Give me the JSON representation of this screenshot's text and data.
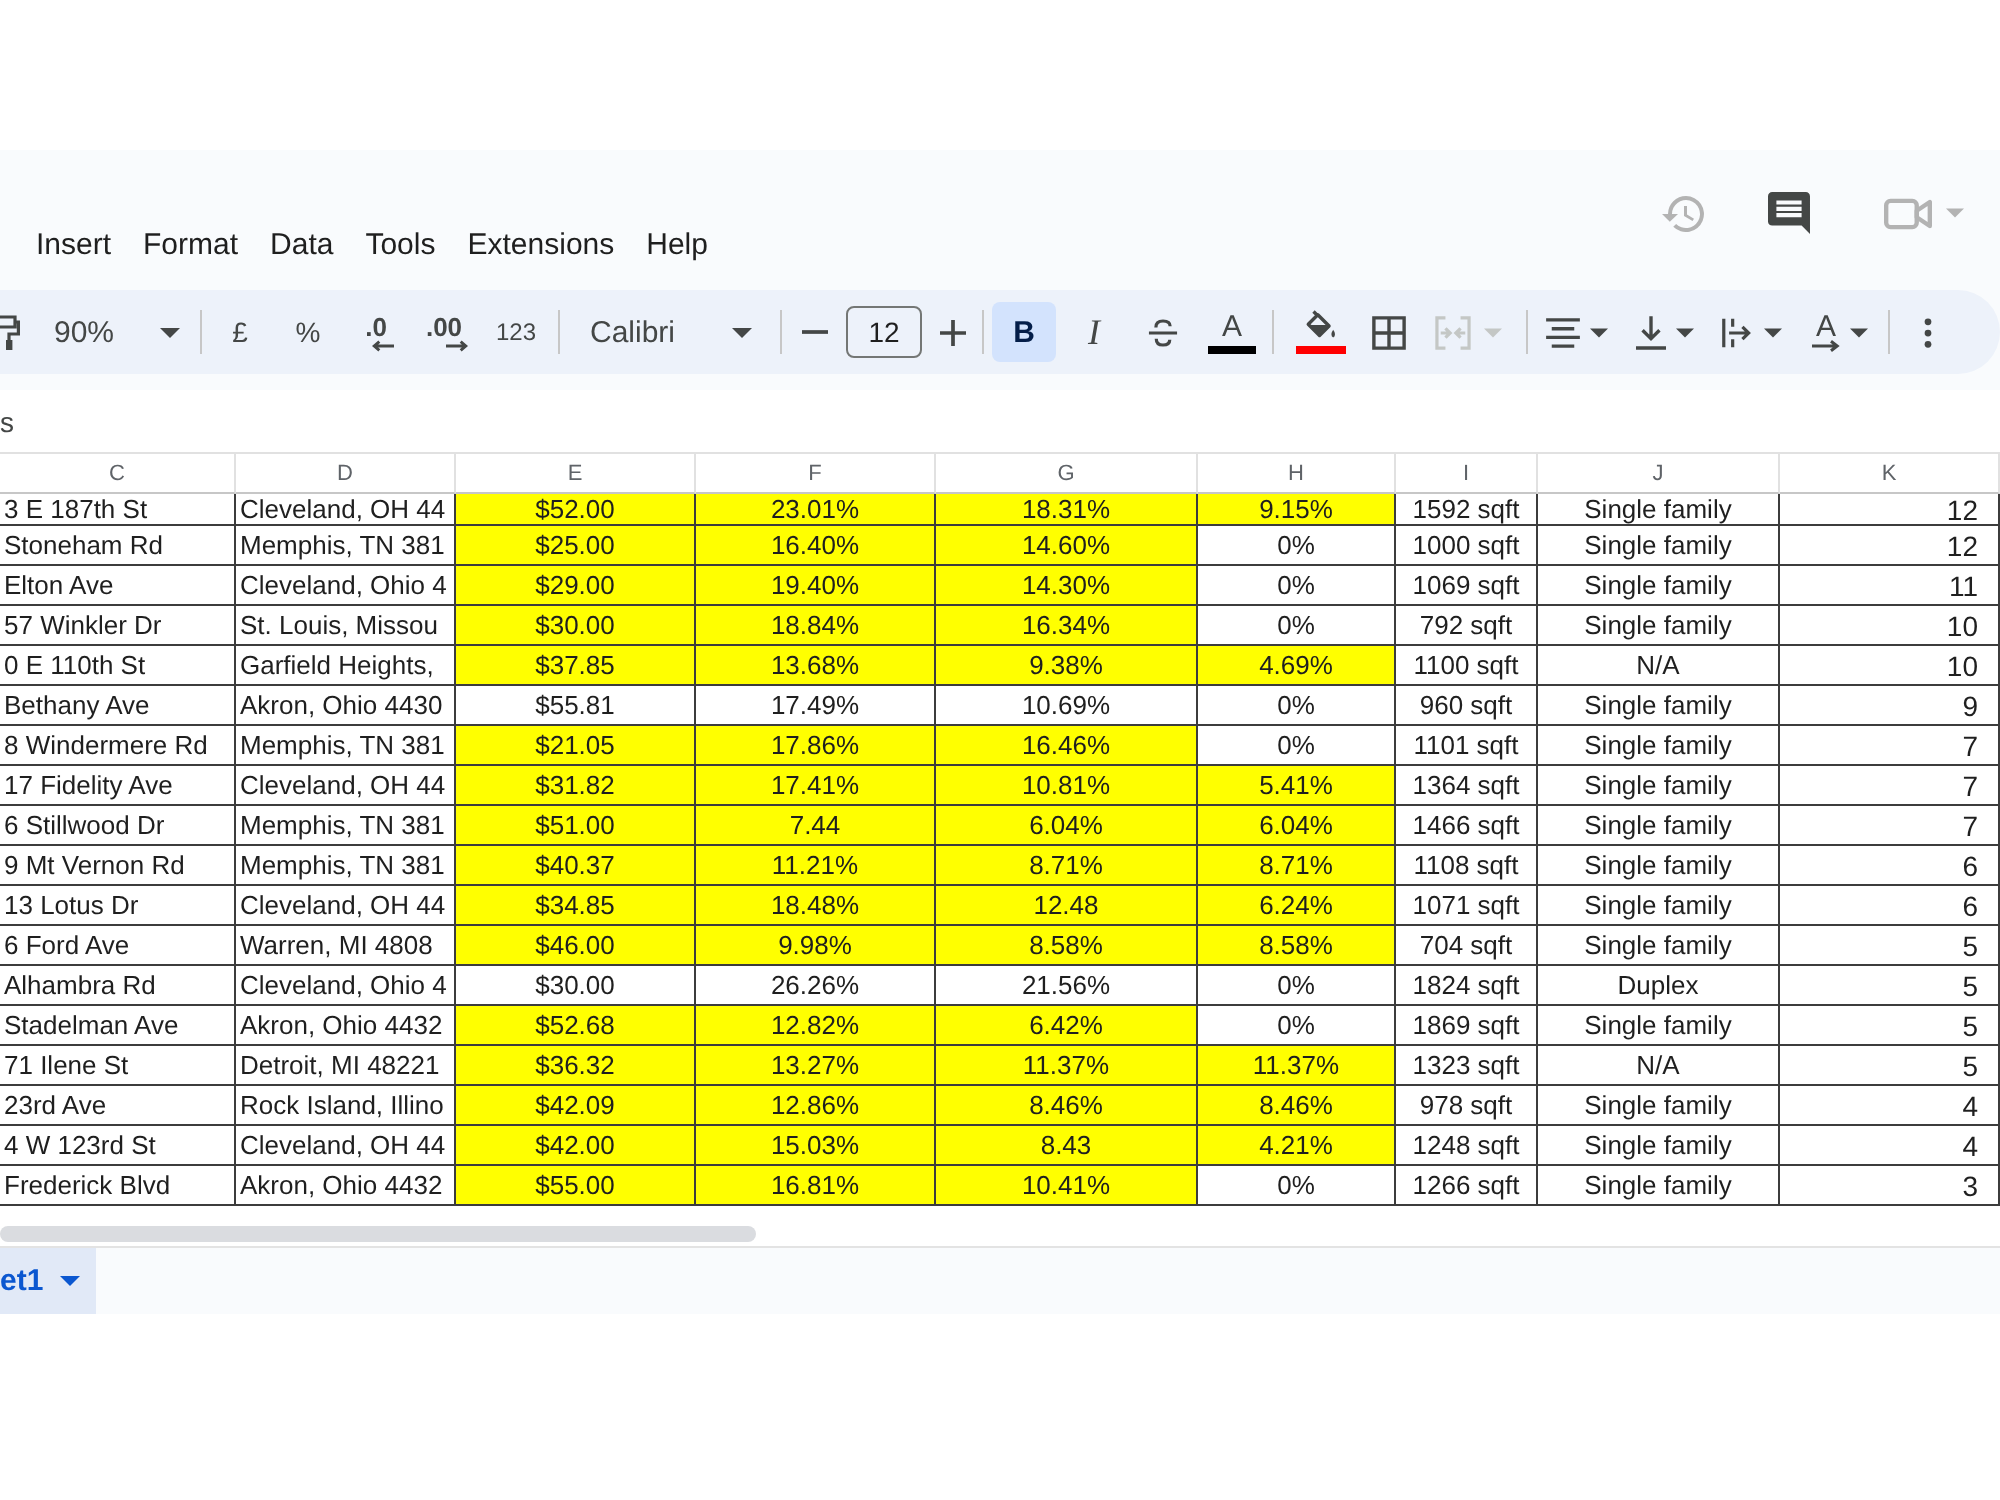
{
  "menu": [
    "Insert",
    "Format",
    "Data",
    "Tools",
    "Extensions",
    "Help"
  ],
  "toolbar": {
    "zoom": "90%",
    "currency": "£",
    "percent": "%",
    "decrease_decimal": ".0",
    "increase_decimal": ".00",
    "number_format": "123",
    "font": "Calibri",
    "font_size": "12",
    "bold": {
      "label": "B",
      "selected": true
    },
    "italic": {
      "label": "I",
      "selected": false
    },
    "strikethrough": {
      "selected": false
    },
    "text_color": {
      "label": "A",
      "color": "#000000"
    },
    "fill_color": {
      "color": "#ff0000"
    },
    "merge": {
      "disabled": true
    },
    "text_rotation": {
      "label": "A"
    }
  },
  "formula_bar": {
    "name_box": "s"
  },
  "sheet": {
    "columns": [
      "C",
      "D",
      "E",
      "F",
      "G",
      "H",
      "I",
      "J",
      "K"
    ],
    "rows": [
      {
        "cells": [
          {
            "text": "3 E 187th St",
            "highlighted": false
          },
          {
            "text": "Cleveland, OH 44",
            "highlighted": false
          },
          {
            "text": "$52.00",
            "highlighted": true
          },
          {
            "text": "23.01%",
            "highlighted": true
          },
          {
            "text": "18.31%",
            "highlighted": true
          },
          {
            "text": "9.15%",
            "highlighted": true
          },
          {
            "text": "1592 sqft",
            "highlighted": false
          },
          {
            "text": "Single family",
            "highlighted": false
          },
          {
            "text": "12",
            "highlighted": false
          }
        ]
      },
      {
        "cells": [
          {
            "text": "Stoneham Rd",
            "highlighted": false
          },
          {
            "text": "Memphis, TN 381",
            "highlighted": false
          },
          {
            "text": "$25.00",
            "highlighted": true
          },
          {
            "text": "16.40%",
            "highlighted": true
          },
          {
            "text": "14.60%",
            "highlighted": true
          },
          {
            "text": "0%",
            "highlighted": false
          },
          {
            "text": "1000 sqft",
            "highlighted": false
          },
          {
            "text": "Single family",
            "highlighted": false
          },
          {
            "text": "12",
            "highlighted": false
          }
        ]
      },
      {
        "cells": [
          {
            "text": "Elton Ave",
            "highlighted": false
          },
          {
            "text": "Cleveland, Ohio 4",
            "highlighted": false
          },
          {
            "text": "$29.00",
            "highlighted": true
          },
          {
            "text": "19.40%",
            "highlighted": true
          },
          {
            "text": "14.30%",
            "highlighted": true
          },
          {
            "text": "0%",
            "highlighted": false
          },
          {
            "text": "1069 sqft",
            "highlighted": false
          },
          {
            "text": "Single family",
            "highlighted": false
          },
          {
            "text": "11",
            "highlighted": false
          }
        ]
      },
      {
        "cells": [
          {
            "text": "57 Winkler Dr",
            "highlighted": false
          },
          {
            "text": "St. Louis, Missou",
            "highlighted": false
          },
          {
            "text": "$30.00",
            "highlighted": true
          },
          {
            "text": "18.84%",
            "highlighted": true
          },
          {
            "text": "16.34%",
            "highlighted": true
          },
          {
            "text": "0%",
            "highlighted": false
          },
          {
            "text": "792 sqft",
            "highlighted": false
          },
          {
            "text": "Single family",
            "highlighted": false
          },
          {
            "text": "10",
            "highlighted": false
          }
        ]
      },
      {
        "cells": [
          {
            "text": "0 E 110th St",
            "highlighted": false
          },
          {
            "text": "Garfield Heights,",
            "highlighted": false
          },
          {
            "text": "$37.85",
            "highlighted": true
          },
          {
            "text": "13.68%",
            "highlighted": true
          },
          {
            "text": "9.38%",
            "highlighted": true
          },
          {
            "text": "4.69%",
            "highlighted": true
          },
          {
            "text": "1100 sqft",
            "highlighted": false
          },
          {
            "text": "N/A",
            "highlighted": false
          },
          {
            "text": "10",
            "highlighted": false
          }
        ]
      },
      {
        "cells": [
          {
            "text": "Bethany Ave",
            "highlighted": false
          },
          {
            "text": "Akron, Ohio 4430",
            "highlighted": false
          },
          {
            "text": "$55.81",
            "highlighted": false
          },
          {
            "text": "17.49%",
            "highlighted": false
          },
          {
            "text": "10.69%",
            "highlighted": false
          },
          {
            "text": "0%",
            "highlighted": false
          },
          {
            "text": "960 sqft",
            "highlighted": false
          },
          {
            "text": "Single family",
            "highlighted": false
          },
          {
            "text": "9",
            "highlighted": false
          }
        ]
      },
      {
        "cells": [
          {
            "text": "8 Windermere Rd",
            "highlighted": false
          },
          {
            "text": "Memphis, TN 381",
            "highlighted": false
          },
          {
            "text": "$21.05",
            "highlighted": true
          },
          {
            "text": "17.86%",
            "highlighted": true
          },
          {
            "text": "16.46%",
            "highlighted": true
          },
          {
            "text": "0%",
            "highlighted": false
          },
          {
            "text": "1101 sqft",
            "highlighted": false
          },
          {
            "text": "Single family",
            "highlighted": false
          },
          {
            "text": "7",
            "highlighted": false
          }
        ]
      },
      {
        "cells": [
          {
            "text": "17 Fidelity Ave",
            "highlighted": false
          },
          {
            "text": "Cleveland, OH 44",
            "highlighted": false
          },
          {
            "text": "$31.82",
            "highlighted": true
          },
          {
            "text": "17.41%",
            "highlighted": true
          },
          {
            "text": "10.81%",
            "highlighted": true
          },
          {
            "text": "5.41%",
            "highlighted": true
          },
          {
            "text": "1364 sqft",
            "highlighted": false
          },
          {
            "text": "Single family",
            "highlighted": false
          },
          {
            "text": "7",
            "highlighted": false
          }
        ]
      },
      {
        "cells": [
          {
            "text": "6 Stillwood Dr",
            "highlighted": false
          },
          {
            "text": "Memphis, TN 381",
            "highlighted": false
          },
          {
            "text": "$51.00",
            "highlighted": true
          },
          {
            "text": "7.44",
            "highlighted": true
          },
          {
            "text": "6.04%",
            "highlighted": true
          },
          {
            "text": "6.04%",
            "highlighted": true
          },
          {
            "text": "1466 sqft",
            "highlighted": false
          },
          {
            "text": "Single family",
            "highlighted": false
          },
          {
            "text": "7",
            "highlighted": false
          }
        ]
      },
      {
        "cells": [
          {
            "text": "9 Mt Vernon Rd",
            "highlighted": false
          },
          {
            "text": "Memphis, TN 381",
            "highlighted": false
          },
          {
            "text": "$40.37",
            "highlighted": true
          },
          {
            "text": "11.21%",
            "highlighted": true
          },
          {
            "text": "8.71%",
            "highlighted": true
          },
          {
            "text": "8.71%",
            "highlighted": true
          },
          {
            "text": "1108 sqft",
            "highlighted": false
          },
          {
            "text": "Single family",
            "highlighted": false
          },
          {
            "text": "6",
            "highlighted": false
          }
        ]
      },
      {
        "cells": [
          {
            "text": "13 Lotus Dr",
            "highlighted": false
          },
          {
            "text": "Cleveland, OH 44",
            "highlighted": false
          },
          {
            "text": "$34.85",
            "highlighted": true
          },
          {
            "text": "18.48%",
            "highlighted": true
          },
          {
            "text": "12.48",
            "highlighted": true
          },
          {
            "text": "6.24%",
            "highlighted": true
          },
          {
            "text": "1071 sqft",
            "highlighted": false
          },
          {
            "text": "Single family",
            "highlighted": false
          },
          {
            "text": "6",
            "highlighted": false
          }
        ]
      },
      {
        "cells": [
          {
            "text": "6 Ford Ave",
            "highlighted": false
          },
          {
            "text": "Warren, MI 4808",
            "highlighted": false
          },
          {
            "text": "$46.00",
            "highlighted": true
          },
          {
            "text": "9.98%",
            "highlighted": true
          },
          {
            "text": "8.58%",
            "highlighted": true
          },
          {
            "text": "8.58%",
            "highlighted": true
          },
          {
            "text": "704 sqft",
            "highlighted": false
          },
          {
            "text": "Single family",
            "highlighted": false
          },
          {
            "text": "5",
            "highlighted": false
          }
        ]
      },
      {
        "cells": [
          {
            "text": "Alhambra Rd",
            "highlighted": false
          },
          {
            "text": "Cleveland, Ohio 4",
            "highlighted": false
          },
          {
            "text": "$30.00",
            "highlighted": false
          },
          {
            "text": "26.26%",
            "highlighted": false
          },
          {
            "text": "21.56%",
            "highlighted": false
          },
          {
            "text": "0%",
            "highlighted": false
          },
          {
            "text": "1824 sqft",
            "highlighted": false
          },
          {
            "text": "Duplex",
            "highlighted": false
          },
          {
            "text": "5",
            "highlighted": false
          }
        ]
      },
      {
        "cells": [
          {
            "text": "Stadelman Ave",
            "highlighted": false
          },
          {
            "text": "Akron, Ohio 4432",
            "highlighted": false
          },
          {
            "text": "$52.68",
            "highlighted": true
          },
          {
            "text": "12.82%",
            "highlighted": true
          },
          {
            "text": "6.42%",
            "highlighted": true
          },
          {
            "text": "0%",
            "highlighted": false
          },
          {
            "text": "1869 sqft",
            "highlighted": false
          },
          {
            "text": "Single family",
            "highlighted": false
          },
          {
            "text": "5",
            "highlighted": false
          }
        ]
      },
      {
        "cells": [
          {
            "text": "71 Ilene St",
            "highlighted": false
          },
          {
            "text": "Detroit, MI 48221",
            "highlighted": false
          },
          {
            "text": "$36.32",
            "highlighted": true
          },
          {
            "text": "13.27%",
            "highlighted": true
          },
          {
            "text": "11.37%",
            "highlighted": true
          },
          {
            "text": "11.37%",
            "highlighted": true
          },
          {
            "text": "1323 sqft",
            "highlighted": false
          },
          {
            "text": "N/A",
            "highlighted": false
          },
          {
            "text": "5",
            "highlighted": false
          }
        ]
      },
      {
        "cells": [
          {
            "text": "23rd Ave",
            "highlighted": false
          },
          {
            "text": "Rock Island, Illino",
            "highlighted": false
          },
          {
            "text": "$42.09",
            "highlighted": true
          },
          {
            "text": "12.86%",
            "highlighted": true
          },
          {
            "text": "8.46%",
            "highlighted": true
          },
          {
            "text": "8.46%",
            "highlighted": true
          },
          {
            "text": "978 sqft",
            "highlighted": false
          },
          {
            "text": "Single family",
            "highlighted": false
          },
          {
            "text": "4",
            "highlighted": false
          }
        ]
      },
      {
        "cells": [
          {
            "text": "4 W 123rd St",
            "highlighted": false
          },
          {
            "text": "Cleveland, OH 44",
            "highlighted": false
          },
          {
            "text": "$42.00",
            "highlighted": true
          },
          {
            "text": "15.03%",
            "highlighted": true
          },
          {
            "text": "8.43",
            "highlighted": true
          },
          {
            "text": "4.21%",
            "highlighted": true
          },
          {
            "text": "1248 sqft",
            "highlighted": false
          },
          {
            "text": "Single family",
            "highlighted": false
          },
          {
            "text": "4",
            "highlighted": false
          }
        ]
      },
      {
        "cells": [
          {
            "text": "Frederick Blvd",
            "highlighted": false
          },
          {
            "text": "Akron, Ohio 4432",
            "highlighted": false
          },
          {
            "text": "$55.00",
            "highlighted": true
          },
          {
            "text": "16.81%",
            "highlighted": true
          },
          {
            "text": "10.41%",
            "highlighted": true
          },
          {
            "text": "0%",
            "highlighted": false
          },
          {
            "text": "1266 sqft",
            "highlighted": false
          },
          {
            "text": "Single family",
            "highlighted": false
          },
          {
            "text": "3",
            "highlighted": false
          }
        ]
      }
    ]
  },
  "sheet_tabs": [
    {
      "label": "et1",
      "selected": true
    }
  ]
}
